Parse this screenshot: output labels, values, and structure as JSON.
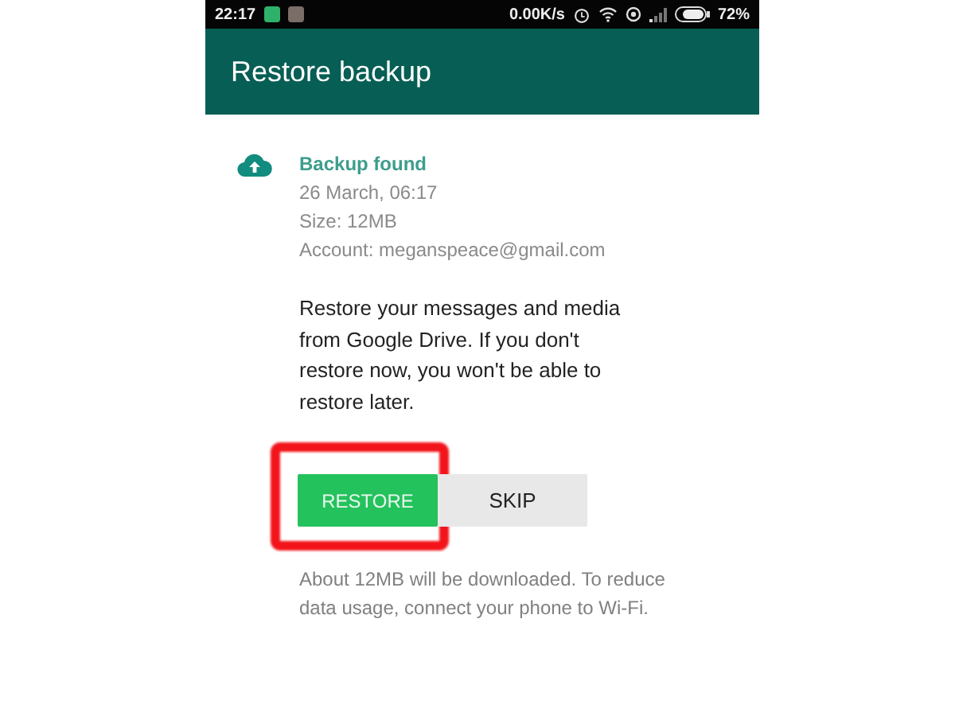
{
  "status_bar": {
    "time": "22:17",
    "speed": "0.00K/s",
    "battery": "72%"
  },
  "app_bar": {
    "title": "Restore backup"
  },
  "backup": {
    "heading": "Backup found",
    "details": [
      "26 March, 06:17",
      "Size: 12MB",
      "Account: meganspeace@gmail.com"
    ]
  },
  "message": "Restore your messages and media from Google Drive. If you don't restore now, you won't be able to restore later.",
  "buttons": [
    {
      "label": "RESTORE",
      "kind": "primary",
      "highlighted": true
    },
    {
      "label": "SKIP",
      "kind": "secondary",
      "highlighted": false
    }
  ],
  "note": "About 12MB will be downloaded. To reduce data usage, connect your phone to Wi-Fi."
}
